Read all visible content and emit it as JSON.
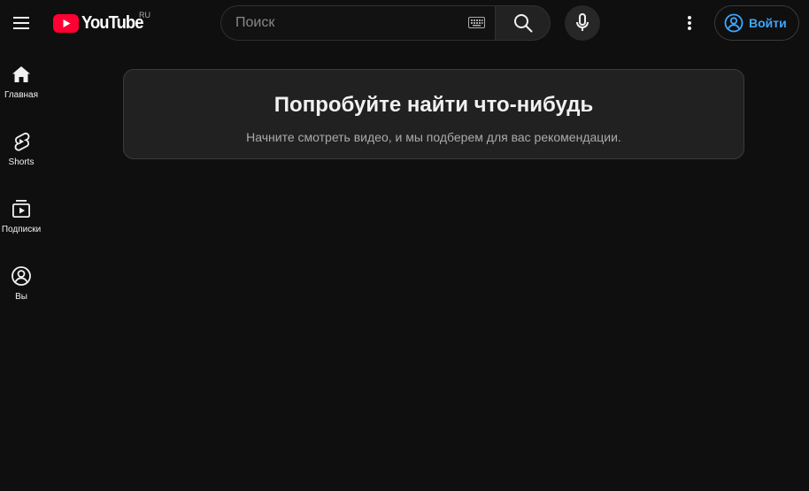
{
  "header": {
    "logo_text": "YouTube",
    "region": "RU",
    "search": {
      "placeholder": "Поиск"
    },
    "signin_label": "Войти"
  },
  "sidebar": {
    "items": [
      {
        "label": "Главная",
        "icon": "home-icon"
      },
      {
        "label": "Shorts",
        "icon": "shorts-icon"
      },
      {
        "label": "Подписки",
        "icon": "subscriptions-icon"
      },
      {
        "label": "Вы",
        "icon": "you-icon"
      }
    ]
  },
  "main": {
    "empty_title": "Попробуйте найти что-нибудь",
    "empty_subtitle": "Начните смотреть видео, и мы подберем для вас рекомендации."
  },
  "colors": {
    "background": "#0f0f0f",
    "brand_red": "#ff0033",
    "link_blue": "#3ea6ff",
    "card_bg": "#212121"
  }
}
